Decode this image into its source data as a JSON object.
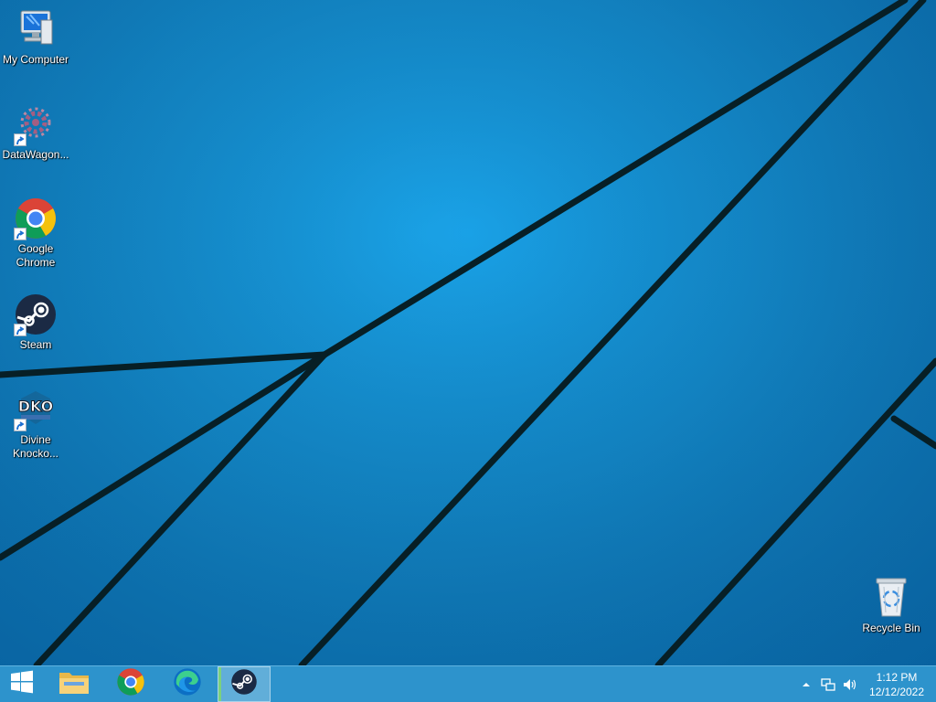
{
  "desktop": {
    "icons": [
      {
        "label": "My Computer",
        "icon": "computer-icon"
      },
      {
        "label": "DataWagon...",
        "icon": "datawagon-icon"
      },
      {
        "label": "Google Chrome",
        "icon": "chrome-icon"
      },
      {
        "label": "Steam",
        "icon": "steam-icon"
      },
      {
        "label": "Divine Knocko...",
        "icon": "dko-game-icon"
      },
      {
        "label": "Recycle Bin",
        "icon": "recycle-bin-icon"
      }
    ],
    "dko_logo_text": "DKO"
  },
  "taskbar": {
    "buttons": [
      {
        "name": "start",
        "icon": "windows-start-icon"
      },
      {
        "name": "file-explorer",
        "icon": "folder-icon"
      },
      {
        "name": "chrome",
        "icon": "chrome-icon"
      },
      {
        "name": "edge",
        "icon": "edge-icon"
      },
      {
        "name": "steam",
        "icon": "steam-icon",
        "active": true
      }
    ],
    "tray": {
      "icons": [
        "show-hidden-icons-chevron",
        "network-icon",
        "volume-icon"
      ]
    },
    "clock": {
      "time": "1:12 PM",
      "date": "12/12/2022"
    }
  },
  "colors": {
    "wallpaper": "#1594da",
    "taskbar": "#2d93cc",
    "wallpaper_lines": "#0a2a33"
  }
}
